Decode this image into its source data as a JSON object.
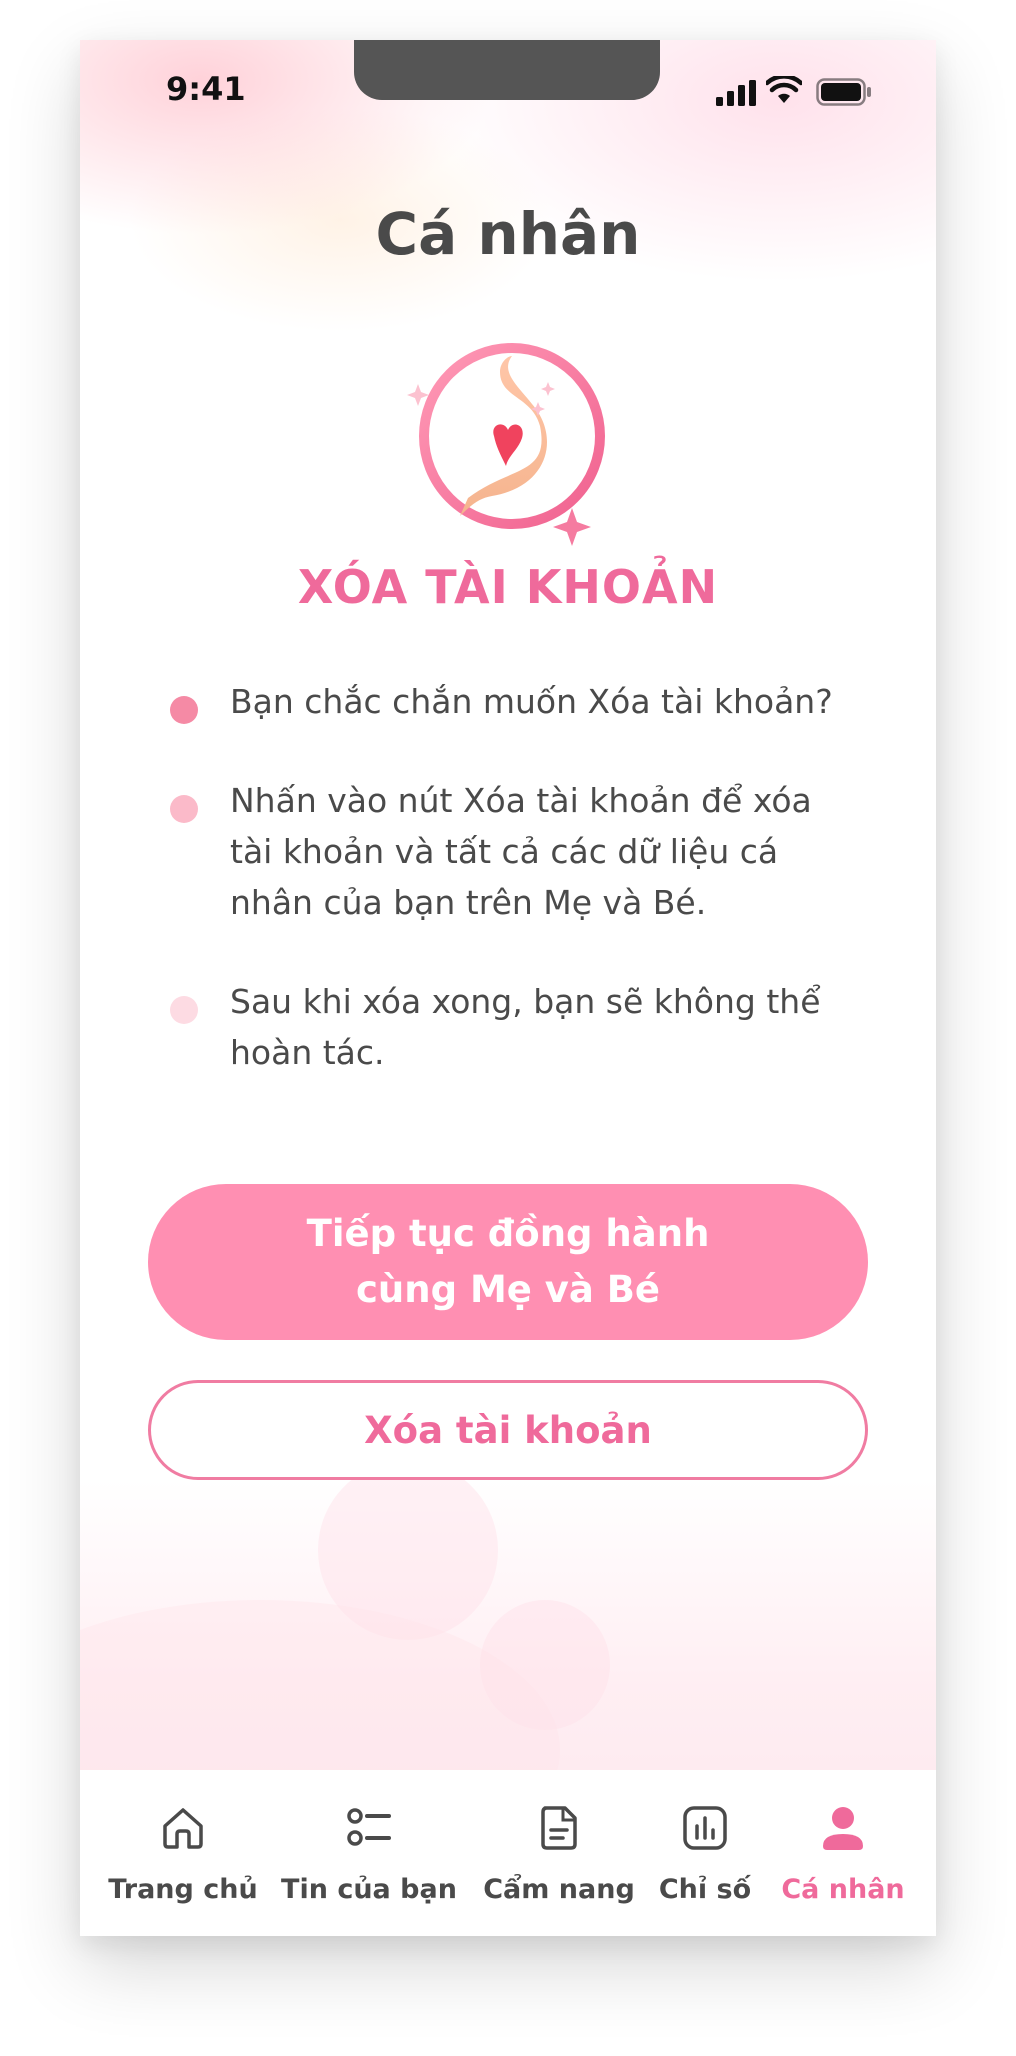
{
  "status_bar": {
    "time": "9:41"
  },
  "page": {
    "title": "Cá nhân"
  },
  "section": {
    "title": "XÓA TÀI KHOẢN"
  },
  "bullets": [
    {
      "text": "Bạn chắc chắn muốn Xóa tài khoản?",
      "dot_color": "#f58aa5"
    },
    {
      "text": "Nhấn vào nút Xóa tài khoản để xóa tài khoản và tất cả các dữ liệu cá nhân của bạn trên Mẹ và Bé.",
      "dot_color": "#fbbac9"
    },
    {
      "text": "Sau khi xóa xong, bạn sẽ không thể hoàn tác.",
      "dot_color": "#fddbe3"
    }
  ],
  "buttons": {
    "continue_line1": "Tiếp tục đồng hành",
    "continue_line2": "cùng Mẹ và Bé",
    "delete": "Xóa tài khoản"
  },
  "tabs": [
    {
      "label": "Trang chủ",
      "icon": "home-icon",
      "active": false
    },
    {
      "label": "Tin của bạn",
      "icon": "list-icon",
      "active": false
    },
    {
      "label": "Cẩm nang",
      "icon": "document-icon",
      "active": false
    },
    {
      "label": "Chỉ số",
      "icon": "chart-icon",
      "active": false
    },
    {
      "label": "Cá nhân",
      "icon": "user-icon",
      "active": true
    }
  ],
  "colors": {
    "accent": "#ef6a9b",
    "primary_button": "#ff8fb2",
    "text": "#4a4a4a"
  }
}
